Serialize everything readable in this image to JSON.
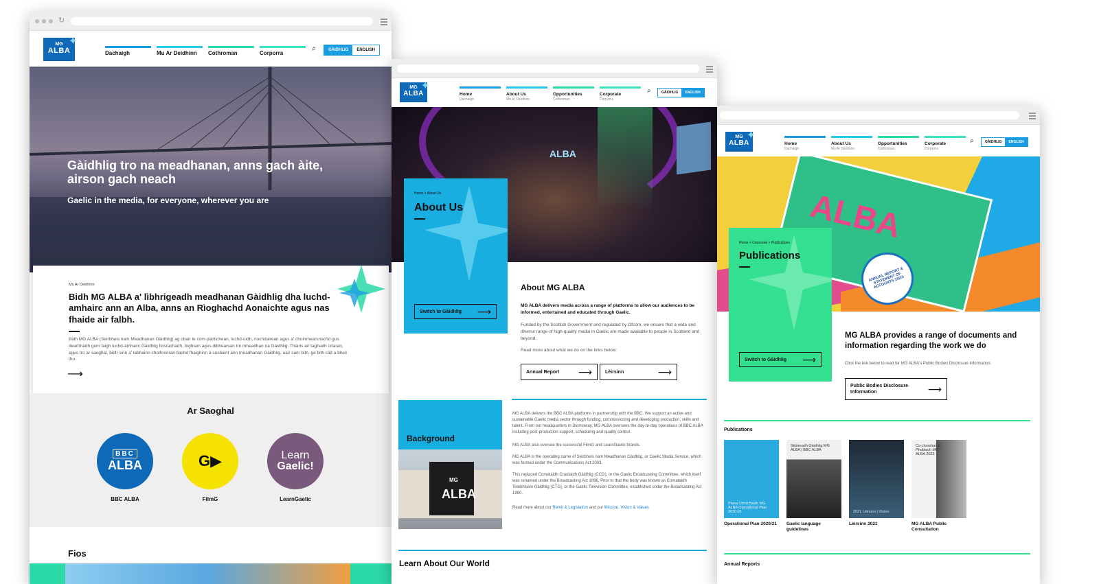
{
  "win1": {
    "logo": {
      "mg": "MG",
      "alba": "ALBA"
    },
    "nav": [
      "Dachaigh",
      "Mu Ar Deidhinn",
      "Cothroman",
      "Corporra"
    ],
    "lang": [
      "GÀIDHLIG",
      "ENGLISH"
    ],
    "hero_title": "Gàidhlig tro na meadhanan, anns gach àite, airson gach neach",
    "hero_sub": "Gaelic in the media, for everyone, wherever you are",
    "card": {
      "eyebrow": "Mu Ar Deidhinn",
      "heading": "Bidh MG ALBA a' lìbhrigeadh meadhanan Gàidhlig dha luchd-amhairc ann an Alba, anns an Rìoghachd Aonaichte agus nas fhaide air falbh.",
      "body": "Bidh MG ALBA (Seirbheis nam Meadhanan Gàidhlig) ag obair le com-pàirtichean, luchd-ùidh, riochdairean agus a' choimhearsnachd gus dearbhadh gum faigh luchd-àmhairc Gàidhlig fiosrachadh, foghlam agus dibhearsan tro mheadhan na Gàidhlig. Thairis air taghadh ùrlaran, agus tro ar saoghal, bidh sinn a' tabhainn chothroman tlachd fhaighinn à susbaint ann meadhanan Gàidhlig, uair sam bith, ge bith càit a bheil thu."
    },
    "saoghal_title": "Ar Saoghal",
    "brands": [
      {
        "logo_top": "BBC",
        "logo_main": "ALBA",
        "label": "BBC ALBA",
        "color": "#0e6ab8"
      },
      {
        "logo_main": "G▶",
        "label": "FilmG",
        "color": "#f5e200"
      },
      {
        "logo_top": "Learn",
        "logo_main": "Gaelic!",
        "label": "LearnGaelic",
        "color": "#7a5a7c"
      }
    ],
    "fios": "Fios"
  },
  "win2": {
    "logo": {
      "mg": "MG",
      "alba": "ALBA"
    },
    "nav": [
      {
        "label": "Home",
        "sub": "Dachaigh"
      },
      {
        "label": "About Us",
        "sub": "Mu Ar Deidhinn"
      },
      {
        "label": "Opportunities",
        "sub": "Cothroman"
      },
      {
        "label": "Corporate",
        "sub": "Corporra"
      }
    ],
    "lang": [
      "GÀIDHLIG",
      "ENGLISH"
    ],
    "crumb": "Home > About Us",
    "panel_title": "About Us",
    "switch_btn": "Switch to Gàidhlig",
    "hero_sign": "ALBA",
    "about_title": "About MG ALBA",
    "about_lead": "MG ALBA delivers media across a range of platforms to allow our audiences to be informed, entertained and educated through Gaelic.",
    "about_p1": "Funded by the Scottish Government and regulated by Ofcom, we ensure that a wide and diverse range of high-quality media in Gaelic are made available to people in Scotland and beyond.",
    "about_p2": "Read more about what we do on the links below:",
    "btn_annual": "Annual Report",
    "btn_leirsinn": "Lèirsinn",
    "background_title": "Background",
    "building_sign": "ALBA",
    "building_mg": "MG",
    "bg_p1": "MG ALBA delivers the BBC ALBA platforms in partnership with the BBC. We support an active and sustainable Gaelic media sector through funding, commissioning and developing production, skills and talent. From our headquarters in Stornoway, MG ALBA oversees the day-to-day operations of BBC ALBA including post-production support, scheduling and quality control.",
    "bg_p2": "MG ALBA also oversee the successful FilmG and LearnGaelic brands.",
    "bg_p3": "MG ALBA is the operating name of Seirbheis nam Meadhanan Gàidhlig, or Gaelic Media Service, which was formed under the Communications Act 2003.",
    "bg_p4": "This replaced Comataidh Craolaidh Gàidhlig (CCG), or the Gaelic Broadcasting Committee, which itself was renamed under the Broadcasting Act 1996. Prior to that the body was known as Comataidh Telebhisein Gàidhlig (CTG), or the Gaelic Television Committee, established under the Broadcasting Act 1990.",
    "bg_p5_pre": "Read more about our",
    "bg_link1": "Remit & Legislation",
    "bg_p5_mid": "and our",
    "bg_link2": "Mission, Vision & Values",
    "learn_title": "Learn About Our World"
  },
  "win3": {
    "logo": {
      "mg": "MG",
      "alba": "ALBA"
    },
    "nav": [
      {
        "label": "Home",
        "sub": "Dachaigh"
      },
      {
        "label": "About Us",
        "sub": "Mu Ar Deidhinn"
      },
      {
        "label": "Opportunities",
        "sub": "Cothroman"
      },
      {
        "label": "Corporate",
        "sub": "Corporra"
      }
    ],
    "lang": [
      "GÀIDHLIG",
      "ENGLISH"
    ],
    "crumb": "Home > Corporate > Publications",
    "panel_title": "Publications",
    "switch_btn": "Switch to Gàidhlig",
    "hero_word": "ALBA",
    "report_badge": "ANNUAL REPORT & STATEMENT OF ACCOUNTS 19/20",
    "intro_title": "MG ALBA provides a range of documents and information regarding the work we do",
    "intro_p": "Click the link below to read for MG ALBA's Public Bodies Disclosure Information:",
    "btn_disclosure": "Public Bodies Disclosure Information",
    "pubs_label": "Publications",
    "pubs": [
      {
        "label": "Operational Plan 2020/21",
        "cover": "Plana Obrachaidh MG ALBA Operational Plan 2020-21",
        "bg": "#29a9dd"
      },
      {
        "label": "Gaelic language guidelines",
        "cover": "Stiùireadh Gàidhlig MG ALBA | BBC ALBA",
        "bg": "#555555"
      },
      {
        "label": "Lèirsinn 2021",
        "cover": "2021 Lèirsinn | Vision",
        "bg": "#1f2a36"
      },
      {
        "label": "MG ALBA Public Consultation",
        "cover": "Co-chomhairle Phoblach MG ALBA 2023",
        "bg": "#d9d9d9"
      }
    ],
    "annual_label": "Annual Reports"
  }
}
